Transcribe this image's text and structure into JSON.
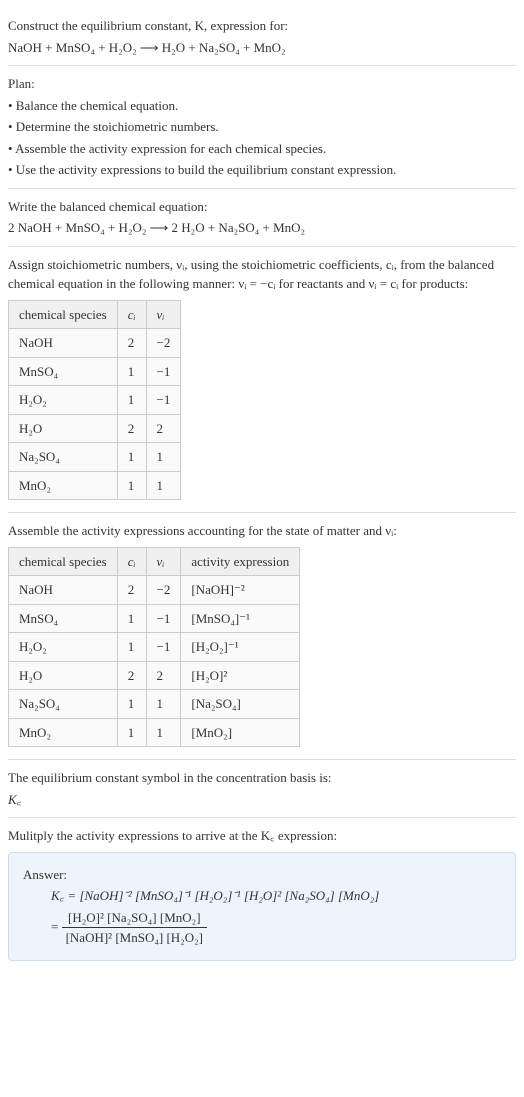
{
  "intro": {
    "line1": "Construct the equilibrium constant, K, expression for:",
    "equation": "NaOH + MnSO₄ + H₂O₂  ⟶  H₂O + Na₂SO₄ + MnO₂"
  },
  "plan": {
    "title": "Plan:",
    "bullet1": "• Balance the chemical equation.",
    "bullet2": "• Determine the stoichiometric numbers.",
    "bullet3": "• Assemble the activity expression for each chemical species.",
    "bullet4": "• Use the activity expressions to build the equilibrium constant expression."
  },
  "balanced": {
    "title": "Write the balanced chemical equation:",
    "equation": "2 NaOH + MnSO₄ + H₂O₂  ⟶  2 H₂O + Na₂SO₄ + MnO₂"
  },
  "assign": {
    "text": "Assign stoichiometric numbers, νᵢ, using the stoichiometric coefficients, cᵢ, from the balanced chemical equation in the following manner: νᵢ = −cᵢ for reactants and νᵢ = cᵢ for products:"
  },
  "table1": {
    "headers": {
      "species": "chemical species",
      "ci": "cᵢ",
      "vi": "νᵢ"
    },
    "rows": [
      {
        "species": "NaOH",
        "ci": "2",
        "vi": "−2"
      },
      {
        "species": "MnSO₄",
        "ci": "1",
        "vi": "−1"
      },
      {
        "species": "H₂O₂",
        "ci": "1",
        "vi": "−1"
      },
      {
        "species": "H₂O",
        "ci": "2",
        "vi": "2"
      },
      {
        "species": "Na₂SO₄",
        "ci": "1",
        "vi": "1"
      },
      {
        "species": "MnO₂",
        "ci": "1",
        "vi": "1"
      }
    ]
  },
  "assemble": {
    "text": "Assemble the activity expressions accounting for the state of matter and νᵢ:"
  },
  "table2": {
    "headers": {
      "species": "chemical species",
      "ci": "cᵢ",
      "vi": "νᵢ",
      "activity": "activity expression"
    },
    "rows": [
      {
        "species": "NaOH",
        "ci": "2",
        "vi": "−2",
        "activity": "[NaOH]⁻²"
      },
      {
        "species": "MnSO₄",
        "ci": "1",
        "vi": "−1",
        "activity": "[MnSO₄]⁻¹"
      },
      {
        "species": "H₂O₂",
        "ci": "1",
        "vi": "−1",
        "activity": "[H₂O₂]⁻¹"
      },
      {
        "species": "H₂O",
        "ci": "2",
        "vi": "2",
        "activity": "[H₂O]²"
      },
      {
        "species": "Na₂SO₄",
        "ci": "1",
        "vi": "1",
        "activity": "[Na₂SO₄]"
      },
      {
        "species": "MnO₂",
        "ci": "1",
        "vi": "1",
        "activity": "[MnO₂]"
      }
    ]
  },
  "symbol": {
    "text": "The equilibrium constant symbol in the concentration basis is:",
    "kc": "K꜀"
  },
  "multiply": {
    "text": "Mulitply the activity expressions to arrive at the K꜀ expression:"
  },
  "answer": {
    "label": "Answer:",
    "line1": "K꜀ = [NaOH]⁻² [MnSO₄]⁻¹ [H₂O₂]⁻¹ [H₂O]² [Na₂SO₄] [MnO₂]",
    "eqprefix": "= ",
    "numerator": "[H₂O]² [Na₂SO₄] [MnO₂]",
    "denominator": "[NaOH]² [MnSO₄] [H₂O₂]"
  }
}
